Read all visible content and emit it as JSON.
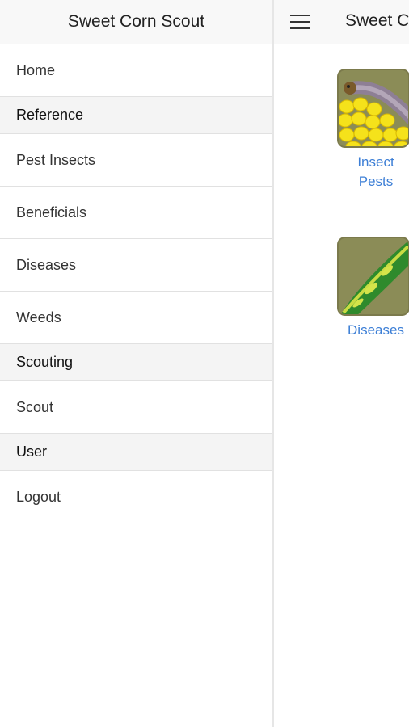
{
  "drawer": {
    "title": "Sweet Corn Scout",
    "items": [
      {
        "type": "item",
        "label": "Home"
      },
      {
        "type": "divider",
        "label": "Reference"
      },
      {
        "type": "item",
        "label": "Pest Insects"
      },
      {
        "type": "item",
        "label": "Beneficials"
      },
      {
        "type": "item",
        "label": "Diseases"
      },
      {
        "type": "item",
        "label": "Weeds"
      },
      {
        "type": "divider",
        "label": "Scouting"
      },
      {
        "type": "item",
        "label": "Scout"
      },
      {
        "type": "divider",
        "label": "User"
      },
      {
        "type": "item",
        "label": "Logout"
      }
    ]
  },
  "main": {
    "title": "Sweet C",
    "tiles": [
      {
        "label_line1": "Insect",
        "label_line2": "Pests",
        "icon": "caterpillar-on-corn-icon"
      },
      {
        "label": "Diseases",
        "icon": "diseased-leaf-icon"
      }
    ]
  },
  "colors": {
    "link": "#3d7fd6",
    "divider_bg": "#f4f4f4",
    "header_bg": "#f8f8f8"
  }
}
